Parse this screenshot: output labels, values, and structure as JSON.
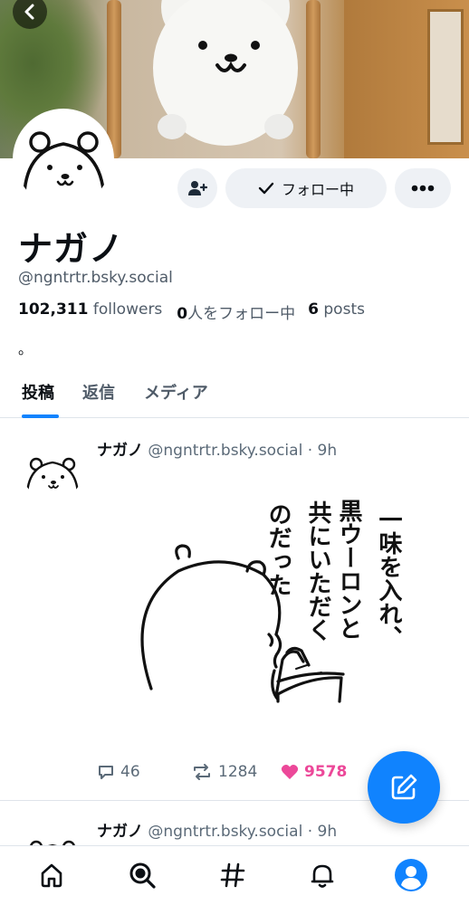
{
  "colors": {
    "accent": "#1083fe",
    "like": "#ec4899",
    "muted": "#4f5b68"
  },
  "profile": {
    "display_name": "ナガノ",
    "handle": "@ngntrtr.bsky.social",
    "followers_count": "102,311",
    "followers_label": "followers",
    "following_count": "0",
    "following_label": "人をフォロー中",
    "posts_count": "6",
    "posts_label": "posts",
    "bio": "。"
  },
  "actions": {
    "follow_label": "フォロー中",
    "follow_icon": "check-icon",
    "add_user_icon": "person-add-icon",
    "more_icon": "ellipsis-icon"
  },
  "tabs": [
    {
      "label": "投稿",
      "active": true
    },
    {
      "label": "返信",
      "active": false
    },
    {
      "label": "メディア",
      "active": false
    }
  ],
  "posts": [
    {
      "author": "ナガノ",
      "handle": "@ngntrtr.bsky.social",
      "time": "· 9h",
      "image_text": [
        "一味を入れ、",
        "黒ウーロンと",
        "共にいただく",
        "のだった"
      ],
      "replies": "46",
      "reposts": "1284",
      "likes": "9578"
    },
    {
      "author": "ナガノ",
      "handle": "@ngntrtr.bsky.social",
      "time": "· 9h"
    }
  ],
  "bottom_nav": [
    "home-icon",
    "search-icon",
    "feeds-hash-icon",
    "notifications-bell-icon",
    "profile-icon"
  ]
}
